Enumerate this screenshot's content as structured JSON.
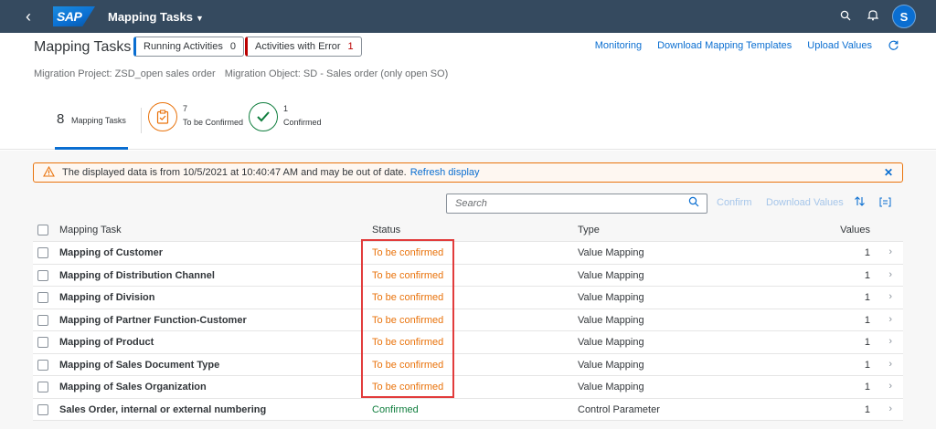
{
  "shell": {
    "logo": "SAP",
    "app_title": "Mapping Tasks",
    "avatar_letter": "S"
  },
  "header": {
    "title": "Mapping Tasks",
    "running_label": "Running Activities",
    "running_count": "0",
    "errors_label": "Activities with Error",
    "errors_count": "1",
    "links": [
      "Monitoring",
      "Download Mapping Templates",
      "Upload Values"
    ],
    "project": "Migration Project: ZSD_open sales order",
    "object": "Migration Object: SD - Sales order (only open SO)"
  },
  "kpis": {
    "all_count": "8",
    "all_label": "Mapping Tasks",
    "tbc_count": "7",
    "tbc_label": "To be Confirmed",
    "conf_count": "1",
    "conf_label": "Confirmed"
  },
  "message": {
    "text": "The displayed data is from 10/5/2021 at 10:40:47 AM and may be out of date.",
    "link": "Refresh display"
  },
  "toolbar": {
    "search_placeholder": "Search",
    "confirm": "Confirm",
    "download_values": "Download Values"
  },
  "table": {
    "headers": {
      "task": "Mapping Task",
      "status": "Status",
      "type": "Type",
      "values": "Values"
    },
    "rows": [
      {
        "task": "Mapping of Customer",
        "status": "To be confirmed",
        "type": "Value Mapping",
        "values": "1"
      },
      {
        "task": "Mapping of Distribution Channel",
        "status": "To be confirmed",
        "type": "Value Mapping",
        "values": "1"
      },
      {
        "task": "Mapping of Division",
        "status": "To be confirmed",
        "type": "Value Mapping",
        "values": "1"
      },
      {
        "task": "Mapping of Partner Function-Customer",
        "status": "To be confirmed",
        "type": "Value Mapping",
        "values": "1"
      },
      {
        "task": "Mapping of Product",
        "status": "To be confirmed",
        "type": "Value Mapping",
        "values": "1"
      },
      {
        "task": "Mapping of Sales Document Type",
        "status": "To be confirmed",
        "type": "Value Mapping",
        "values": "1"
      },
      {
        "task": "Mapping of Sales Organization",
        "status": "To be confirmed",
        "type": "Value Mapping",
        "values": "1"
      },
      {
        "task": "Sales Order, internal or external numbering",
        "status": "Confirmed",
        "type": "Control Parameter",
        "values": "1"
      }
    ]
  },
  "colors": {
    "shell": "#354a5f",
    "accent": "#0a6ed1",
    "warning": "#e9730c",
    "success": "#107e3e",
    "error": "#bb0000",
    "annotation": "#e23c3c"
  }
}
